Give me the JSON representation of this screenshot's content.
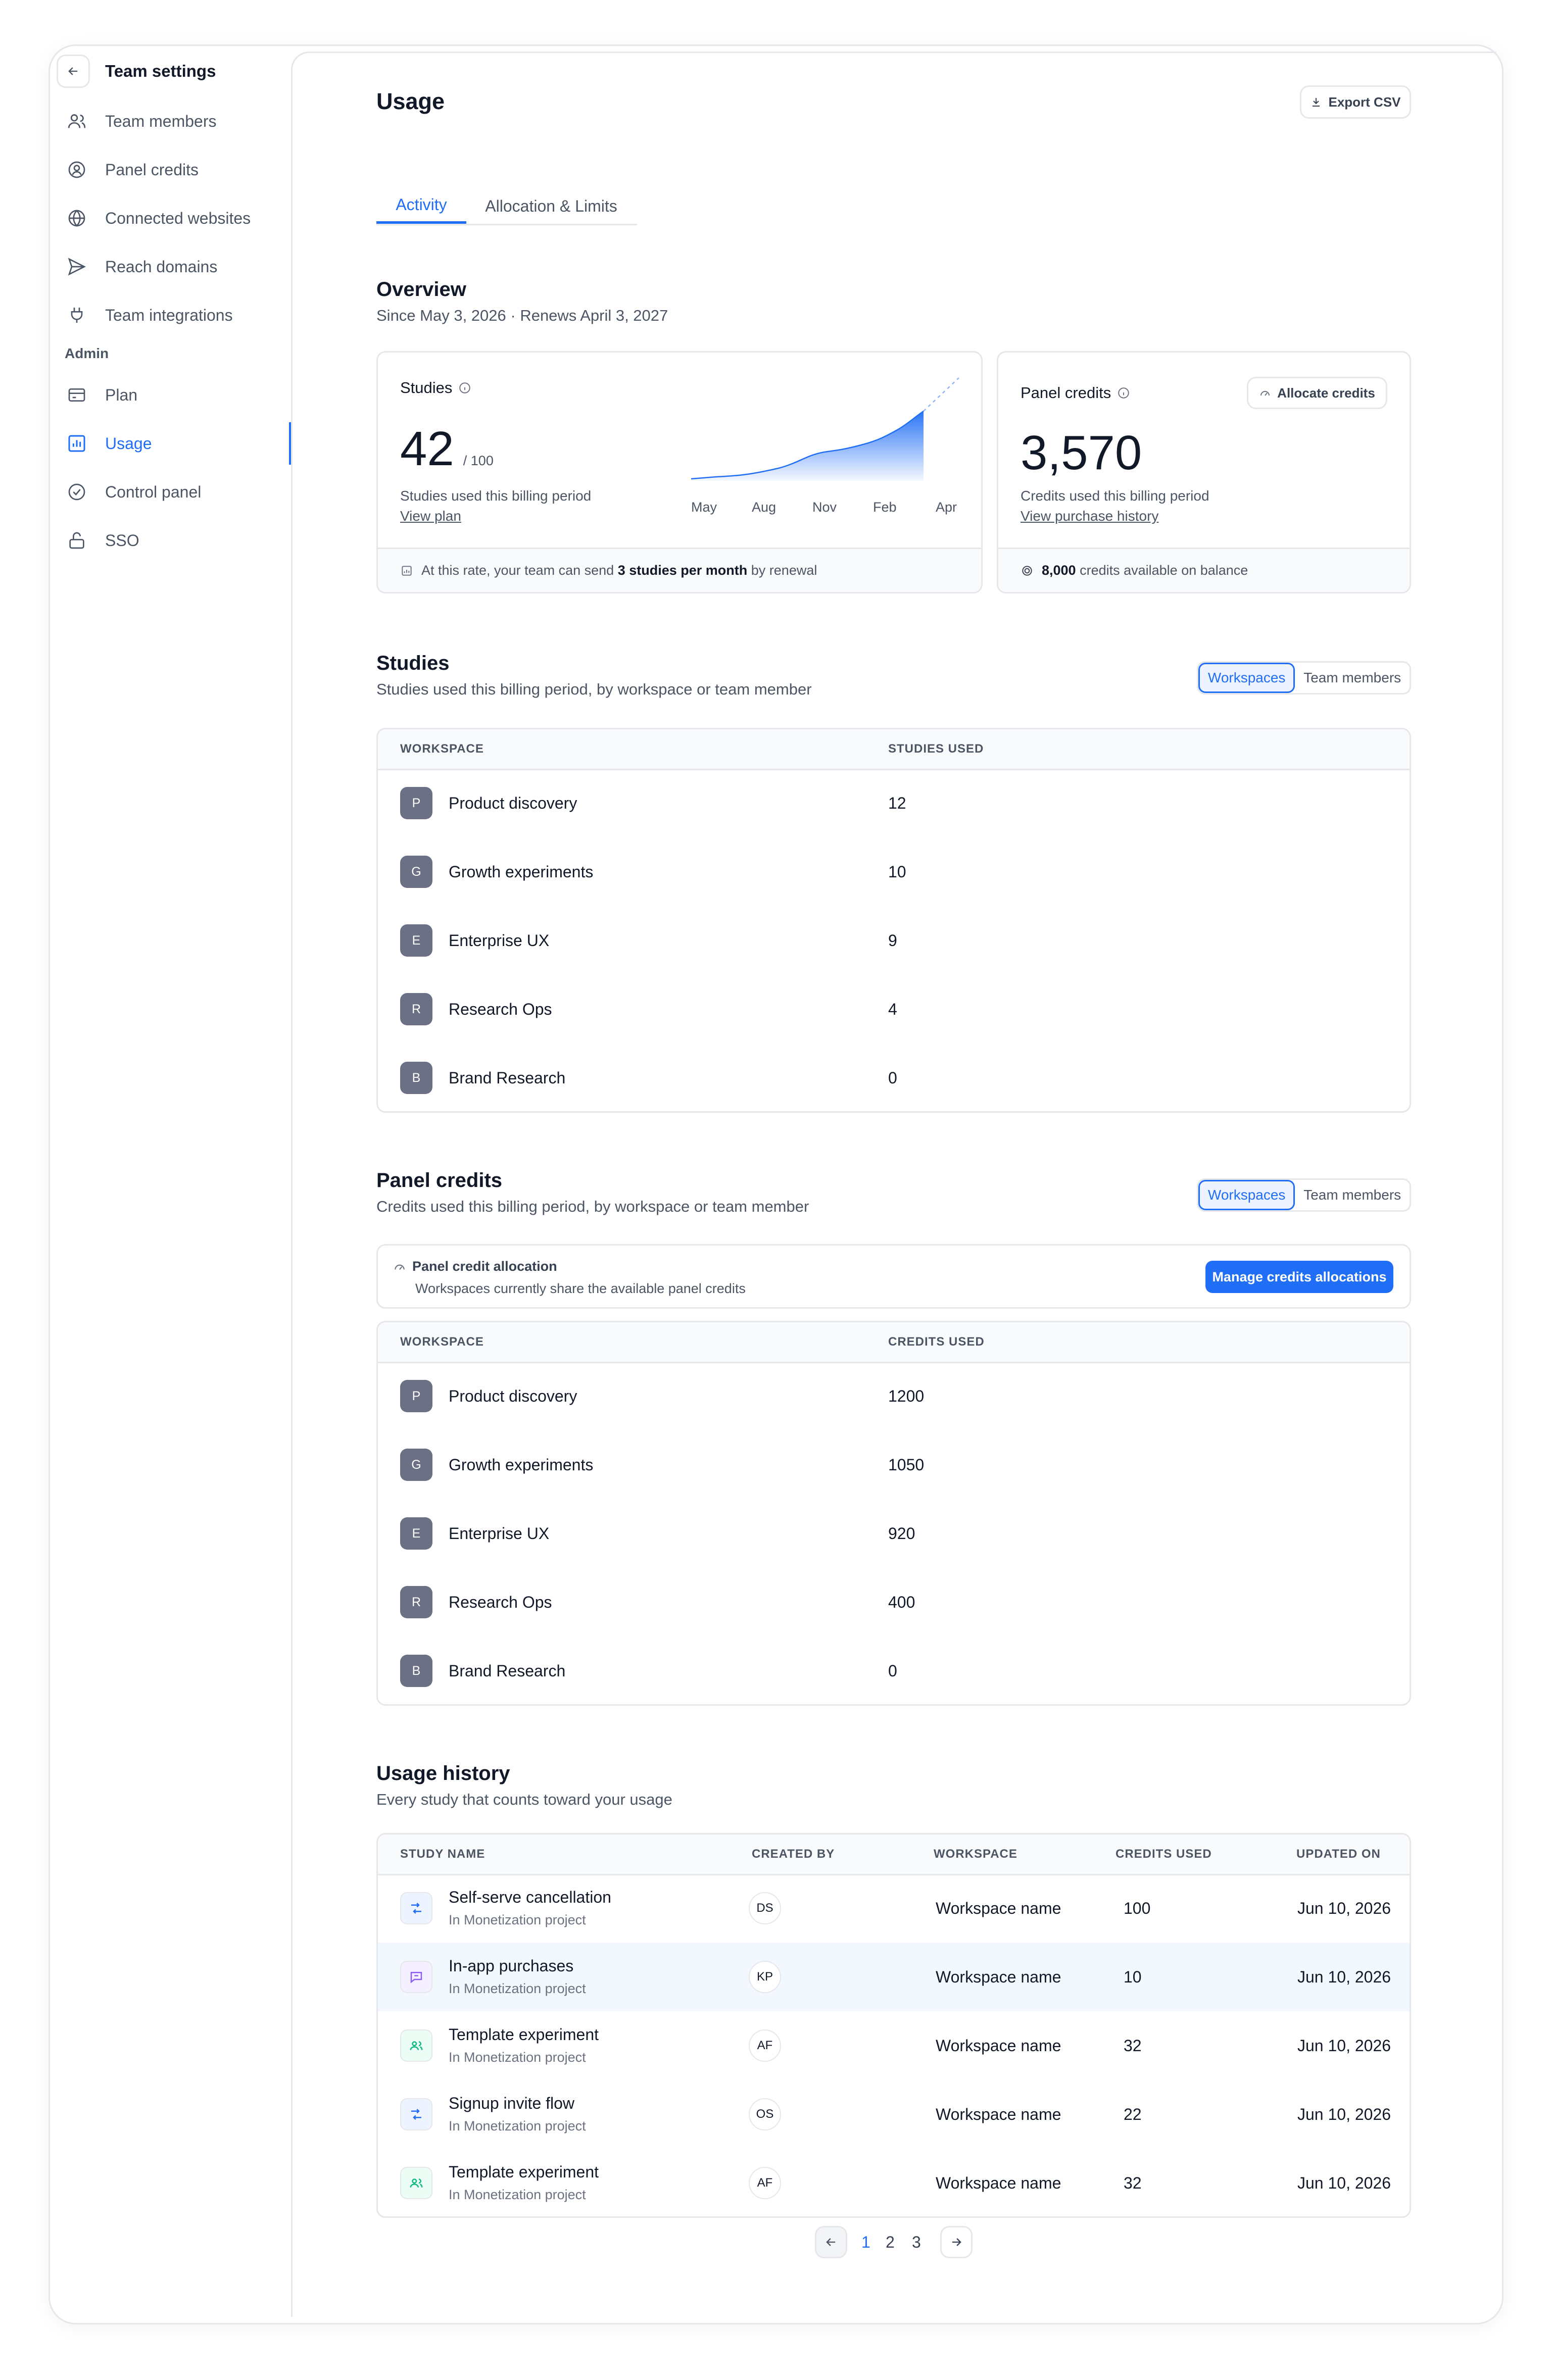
{
  "sidebar": {
    "title": "Team settings",
    "items": [
      {
        "label": "Team members",
        "icon": "users-icon"
      },
      {
        "label": "Panel credits",
        "icon": "panel-credits-icon"
      },
      {
        "label": "Connected websites",
        "icon": "globe-icon"
      },
      {
        "label": "Reach domains",
        "icon": "send-icon"
      },
      {
        "label": "Team integrations",
        "icon": "plug-icon"
      }
    ],
    "admin_label": "Admin",
    "admin_items": [
      {
        "label": "Plan",
        "icon": "credit-card-icon"
      },
      {
        "label": "Usage",
        "icon": "bar-chart-icon",
        "active": true
      },
      {
        "label": "Control panel",
        "icon": "check-circle-icon"
      },
      {
        "label": "SSO",
        "icon": "lock-icon"
      }
    ]
  },
  "header": {
    "title": "Usage",
    "export_label": "Export CSV"
  },
  "tabs": [
    {
      "label": "Activity",
      "active": true
    },
    {
      "label": "Allocation & Limits"
    }
  ],
  "overview": {
    "title": "Overview",
    "subtitle": "Since May 3, 2026 · Renews April 3, 2027",
    "studies_card": {
      "label": "Studies",
      "value": "42",
      "limit": "/ 100",
      "caption": "Studies used this billing period",
      "link": "View plan",
      "footer_pre": "At this rate, your team can send",
      "footer_bold": "3 studies per month",
      "footer_post": "by renewal",
      "chart_labels": [
        "May",
        "Aug",
        "Nov",
        "Feb",
        "Apr"
      ]
    },
    "credits_card": {
      "label": "Panel credits",
      "allocate_label": "Allocate credits",
      "value": "3,570",
      "caption": "Credits used this billing period",
      "link": "View purchase history",
      "footer_bold": "8,000",
      "footer_post": "credits available on balance"
    }
  },
  "studies": {
    "title": "Studies",
    "subtitle": "Studies used this billing period, by workspace or team member",
    "toggle": [
      "Workspaces",
      "Team members"
    ],
    "columns": [
      "WORKSPACE",
      "STUDIES USED"
    ],
    "rows": [
      {
        "initial": "P",
        "name": "Product discovery",
        "value": "12"
      },
      {
        "initial": "G",
        "name": "Growth experiments",
        "value": "10"
      },
      {
        "initial": "E",
        "name": "Enterprise UX",
        "value": "9"
      },
      {
        "initial": "R",
        "name": "Research Ops",
        "value": "4"
      },
      {
        "initial": "B",
        "name": "Brand Research",
        "value": "0"
      }
    ]
  },
  "panel_credits": {
    "title": "Panel credits",
    "subtitle": "Credits used this billing period, by workspace or team member",
    "toggle": [
      "Workspaces",
      "Team members"
    ],
    "allocation_title": "Panel credit allocation",
    "allocation_desc": "Workspaces currently share the available panel credits",
    "manage_label": "Manage credits allocations",
    "columns": [
      "WORKSPACE",
      "CREDITS USED"
    ],
    "rows": [
      {
        "initial": "P",
        "name": "Product discovery",
        "value": "1200"
      },
      {
        "initial": "G",
        "name": "Growth experiments",
        "value": "1050"
      },
      {
        "initial": "E",
        "name": "Enterprise UX",
        "value": "920"
      },
      {
        "initial": "R",
        "name": "Research Ops",
        "value": "400"
      },
      {
        "initial": "B",
        "name": "Brand Research",
        "value": "0"
      }
    ]
  },
  "history": {
    "title": "Usage history",
    "subtitle": "Every study that counts toward your usage",
    "columns": [
      "STUDY NAME",
      "CREATED BY",
      "WORKSPACE",
      "CREDITS USED",
      "UPDATED ON"
    ],
    "rows": [
      {
        "name": "Self-serve cancellation",
        "project": "In Monetization project",
        "by": "DS",
        "workspace": "Workspace name",
        "credits": "100",
        "updated": "Jun 10, 2026",
        "icon": "flow-icon",
        "color": "#1f6ef5"
      },
      {
        "name": "In-app purchases",
        "project": "In Monetization project",
        "by": "KP",
        "workspace": "Workspace name",
        "credits": "10",
        "updated": "Jun 10, 2026",
        "icon": "chat-icon",
        "color": "#8b5cf6"
      },
      {
        "name": "Template experiment",
        "project": "In Monetization project",
        "by": "AF",
        "workspace": "Workspace name",
        "credits": "32",
        "updated": "Jun 10, 2026",
        "icon": "people-icon",
        "color": "#10b981"
      },
      {
        "name": "Signup invite flow",
        "project": "In Monetization project",
        "by": "OS",
        "workspace": "Workspace name",
        "credits": "22",
        "updated": "Jun 10, 2026",
        "icon": "flow-icon",
        "color": "#1f6ef5"
      },
      {
        "name": "Template experiment",
        "project": "In Monetization project",
        "by": "AF",
        "workspace": "Workspace name",
        "credits": "32",
        "updated": "Jun 10, 2026",
        "icon": "people-icon",
        "color": "#10b981"
      }
    ]
  },
  "pagination": {
    "pages": [
      "1",
      "2",
      "3"
    ],
    "current": "1"
  },
  "colors": {
    "accent": "#1f6ef5",
    "avatar": "#6b7085",
    "border": "#e5e7eb"
  }
}
